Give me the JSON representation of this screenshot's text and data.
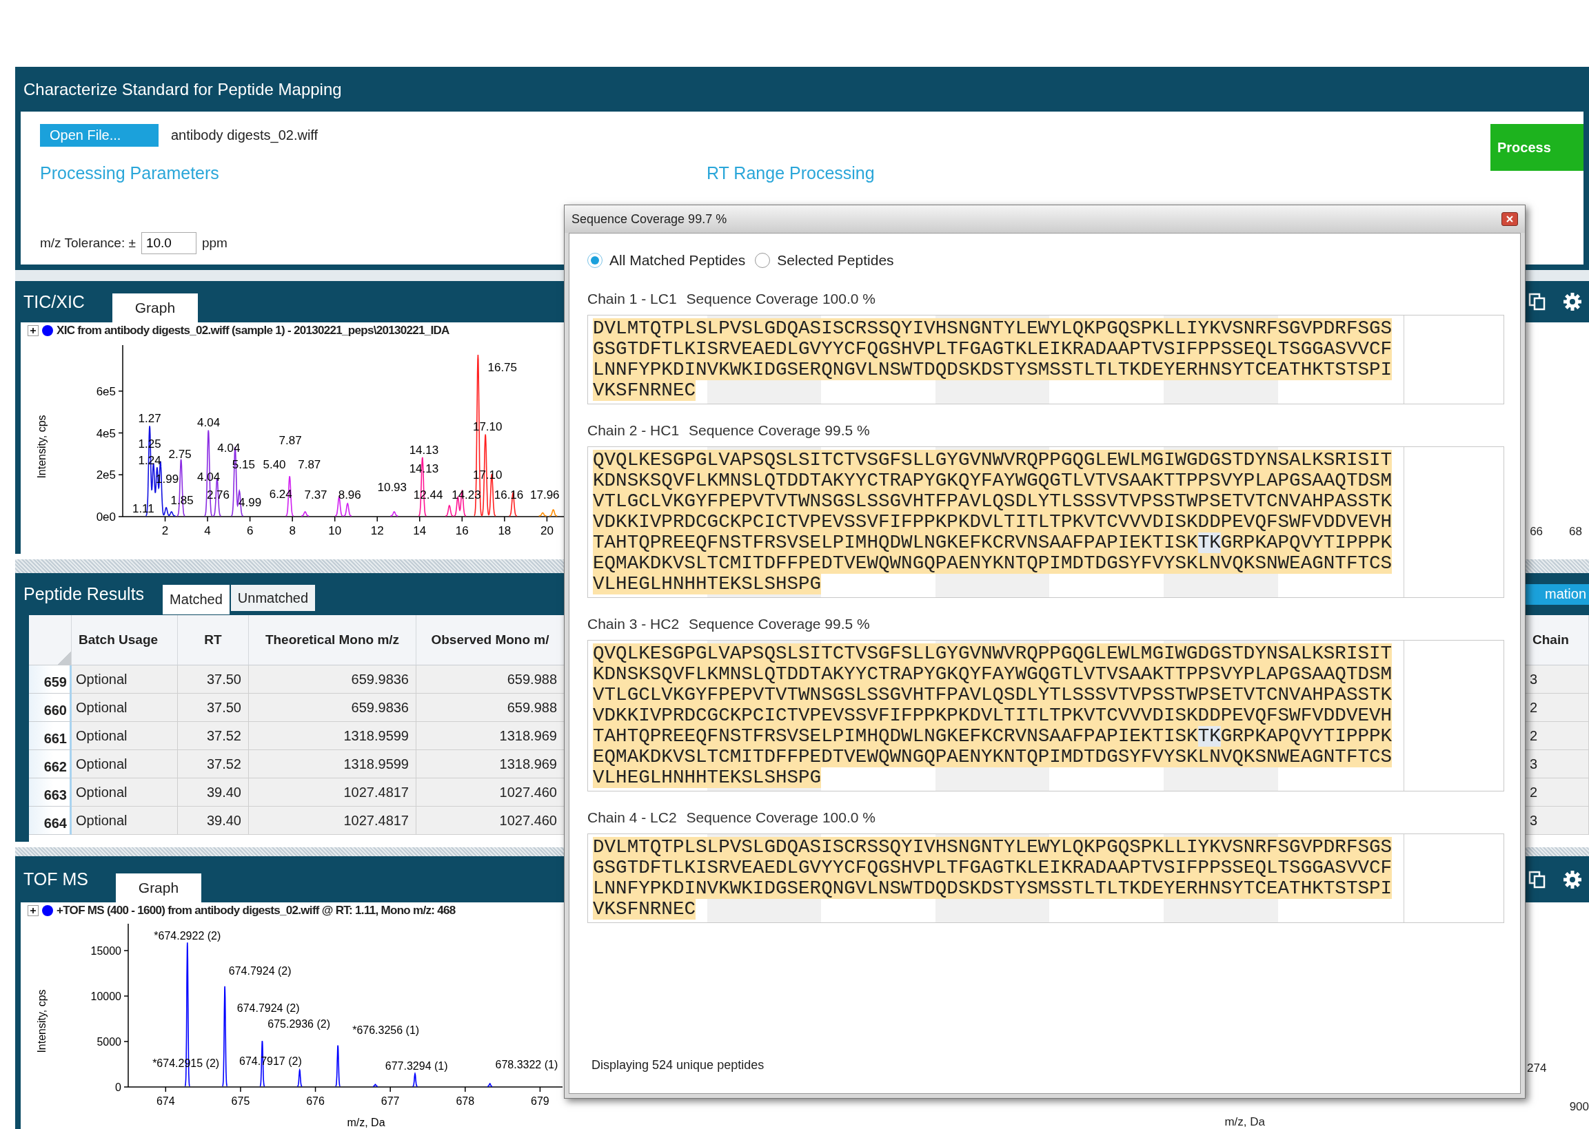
{
  "window": {
    "title": "Characterize Standard for Peptide Mapping"
  },
  "file": {
    "button": "Open File...",
    "name": "antibody digests_02.wiff"
  },
  "process_button": "Process",
  "sections": [
    "Processing Parameters",
    "RT Range Processing"
  ],
  "tolerance": {
    "label": "m/z Tolerance: ±",
    "value": "10.0",
    "unit": "ppm"
  },
  "xic_panel": {
    "title": "TIC/XIC",
    "tabs": [
      {
        "label": "Graph",
        "selected": true
      }
    ],
    "trace_title": "XIC from antibody digests_02.wiff (sample 1) - 20130221_peps\\20130221_IDA",
    "right_ticks": [
      "66",
      "68"
    ],
    "graph": {
      "y_title": "Intensity, cps",
      "y_ticks": [
        "6e5",
        "4e5",
        "2e5",
        "0e0"
      ],
      "x_ticks": [
        "2",
        "4",
        "6",
        "8",
        "10",
        "12",
        "14",
        "16",
        "18",
        "20"
      ],
      "peak_labels": [
        "16.75",
        "17.10",
        "1.27",
        "1.25",
        "1.24",
        "2.75",
        "1.99",
        "1.85",
        "1.11",
        "4.04",
        "4.04",
        "4.04",
        "2.76",
        "5.15",
        "5.40",
        "4.99",
        "7.87",
        "7.87",
        "6.24",
        "7.37",
        "8.96",
        "10.93",
        "14.13",
        "14.13",
        "12.44",
        "14.23",
        "17.10",
        "16.16",
        "17.96"
      ]
    }
  },
  "results_panel": {
    "title": "Peptide Results",
    "tabs": [
      {
        "label": "Matched",
        "selected": true
      },
      {
        "label": "Unmatched",
        "selected": false
      }
    ],
    "side_button": "mation",
    "table": {
      "columns": [
        "Batch Usage",
        "RT",
        "Theoretical Mono m/z",
        "Observed Mono m/"
      ],
      "right_column": "Chain",
      "rows": [
        {
          "index": "659",
          "cells": [
            "Optional",
            "37.50",
            "659.9836",
            "659.988"
          ],
          "chain": "3"
        },
        {
          "index": "660",
          "cells": [
            "Optional",
            "37.50",
            "659.9836",
            "659.988"
          ],
          "chain": "2"
        },
        {
          "index": "661",
          "cells": [
            "Optional",
            "37.52",
            "1318.9599",
            "1318.969"
          ],
          "chain": "2"
        },
        {
          "index": "662",
          "cells": [
            "Optional",
            "37.52",
            "1318.9599",
            "1318.969"
          ],
          "chain": "3"
        },
        {
          "index": "663",
          "cells": [
            "Optional",
            "39.40",
            "1027.4817",
            "1027.460"
          ],
          "chain": "2"
        },
        {
          "index": "664",
          "cells": [
            "Optional",
            "39.40",
            "1027.4817",
            "1027.460"
          ],
          "chain": "3"
        }
      ]
    }
  },
  "tof_panel": {
    "title": "TOF MS",
    "tabs": [
      {
        "label": "Graph",
        "selected": true
      }
    ],
    "trace_title": "+TOF MS (400 - 1600) from antibody digests_02.wiff @ RT: 1.11, Mono m/z: 468",
    "right_peak_label": "274",
    "right_tick": "900",
    "axis_label": "m/z, Da",
    "graph": {
      "x_title": "m/z, Da",
      "y_title": "Intensity, cps",
      "y_ticks": [
        "15000",
        "10000",
        "5000",
        "0"
      ],
      "x_ticks": [
        "674",
        "675",
        "676",
        "677",
        "678",
        "679"
      ],
      "peak_labels": [
        "*674.2922 (2)",
        "674.7924 (2)",
        "674.7924 (2)",
        "675.2936 (2)",
        "*676.3256 (1)",
        "*674.2915 (2)",
        "674.7917 (2)",
        "677.3294 (1)",
        "678.3322 (1)"
      ]
    }
  },
  "dialog": {
    "title": "Sequence Coverage 99.7 %",
    "options": [
      {
        "label": "All Matched Peptides",
        "selected": true
      },
      {
        "label": "Selected Peptides",
        "selected": false
      }
    ],
    "chains": [
      {
        "name": "Chain 1 - LC1",
        "coverage": "Sequence Coverage 100.0 %",
        "lines": [
          [
            {
              "text": "DVLMTQTPLSLPVSLGDQASISCRSSQYIVHSNGNTYLEWYLQKPGQSPKLLIYKVSNRFSGVPDRFSGS",
              "covered": true
            }
          ],
          [
            {
              "text": "GSGTDFTLKISRVEAEDLGVYYCFQGSHVPLTFGAGTKLEIKRADAAPTVSIFPPSSEQLTSGGASVVCF",
              "covered": true
            }
          ],
          [
            {
              "text": "LNNFYPKDINVKWKIDGSERQNGVLNSWTDQDSKDSTYSMSSTLTLTKDEYERHNSYTCEATHKTSTSPI",
              "covered": true
            }
          ],
          [
            {
              "text": "VKSFNRNEC",
              "covered": true
            }
          ]
        ]
      },
      {
        "name": "Chain 2 - HC1",
        "coverage": "Sequence Coverage 99.5 %",
        "lines": [
          [
            {
              "text": "QVQLKESGPGLVAPSQSLSITCTVSGFSLLGYGVNWVRQPPGQGLEWLMGIWGDGSTDYNSALKSRISIT",
              "covered": true
            }
          ],
          [
            {
              "text": "KDNSKSQVFLKMNSLQTDDTAKYYCTRAPYGKQYFAYWGQGTLVTVSAAKTTPPSVYPLAPGSAAQTDSM",
              "covered": true
            }
          ],
          [
            {
              "text": "VTLGCLVKGYFPEPVTVTWNSGSLSSGVHTFPAVLQSDLYTLSSSVTVPSSTWPSETVTCNVAHPASSTK",
              "covered": true
            }
          ],
          [
            {
              "text": "VDKKIVPRDCGCKPCICTVPEVSSVFIFPPKPKDVLTITLTPKVTCVVVDISKDDPEVQFSWFVDDVEVH",
              "covered": true
            }
          ],
          [
            {
              "text": "TAHTQPREEQFNSTFRSVSELPIMHQDWLNGKEFKCRVNSAAFPAPIEKTISK",
              "covered": true
            },
            {
              "text": "TK",
              "covered": false
            },
            {
              "text": "GRPKAPQVYTIPPPK",
              "covered": true
            }
          ],
          [
            {
              "text": "EQMAKDKVSLTCMITDFFPEDTVEWQWNGQPAENYKNTQPIMDTDGSYFVYSKLNVQKSNWEAGNTFTCS",
              "covered": true
            }
          ],
          [
            {
              "text": "VLHEGLHNHHTEKSLSHSPG",
              "covered": true
            }
          ]
        ]
      },
      {
        "name": "Chain 3 - HC2",
        "coverage": "Sequence Coverage 99.5 %",
        "lines": [
          [
            {
              "text": "QVQLKESGPGLVAPSQSLSITCTVSGFSLLGYGVNWVRQPPGQGLEWLMGIWGDGSTDYNSALKSRISIT",
              "covered": true
            }
          ],
          [
            {
              "text": "KDNSKSQVFLKMNSLQTDDTAKYYCTRAPYGKQYFAYWGQGTLVTVSAAKTTPPSVYPLAPGSAAQTDSM",
              "covered": true
            }
          ],
          [
            {
              "text": "VTLGCLVKGYFPEPVTVTWNSGSLSSGVHTFPAVLQSDLYTLSSSVTVPSSTWPSETVTCNVAHPASSTK",
              "covered": true
            }
          ],
          [
            {
              "text": "VDKKIVPRDCGCKPCICTVPEVSSVFIFPPKPKDVLTITLTPKVTCVVVDISKDDPEVQFSWFVDDVEVH",
              "covered": true
            }
          ],
          [
            {
              "text": "TAHTQPREEQFNSTFRSVSELPIMHQDWLNGKEFKCRVNSAAFPAPIEKTISK",
              "covered": true
            },
            {
              "text": "TK",
              "covered": false
            },
            {
              "text": "GRPKAPQVYTIPPPK",
              "covered": true
            }
          ],
          [
            {
              "text": "EQMAKDKVSLTCMITDFFPEDTVEWQWNGQPAENYKNTQPIMDTDGSYFVYSKLNVQKSNWEAGNTFTCS",
              "covered": true
            }
          ],
          [
            {
              "text": "VLHEGLHNHHTEKSLSHSPG",
              "covered": true
            }
          ]
        ]
      },
      {
        "name": "Chain 4 - LC2",
        "coverage": "Sequence Coverage 100.0 %",
        "lines": [
          [
            {
              "text": "DVLMTQTPLSLPVSLGDQASISCRSSQYIVHSNGNTYLEWYLQKPGQSPKLLIYKVSNRFSGVPDRFSGS",
              "covered": true
            }
          ],
          [
            {
              "text": "GSGTDFTLKISRVEAEDLGVYYCFQGSHVPLTFGAGTKLEIKRADAAPTVSIFPPSSEQLTSGGASVVCF",
              "covered": true
            }
          ],
          [
            {
              "text": "LNNFYPKDINVKWKIDGSERQNGVLNSWTDQDSKDSTYSMSSTLTLTKDEYERHNSYTCEATHKTSTSPI",
              "covered": true
            }
          ],
          [
            {
              "text": "VKSFNRNEC",
              "covered": true
            }
          ]
        ]
      }
    ],
    "footer": "Displaying 524 unique peptides"
  }
}
